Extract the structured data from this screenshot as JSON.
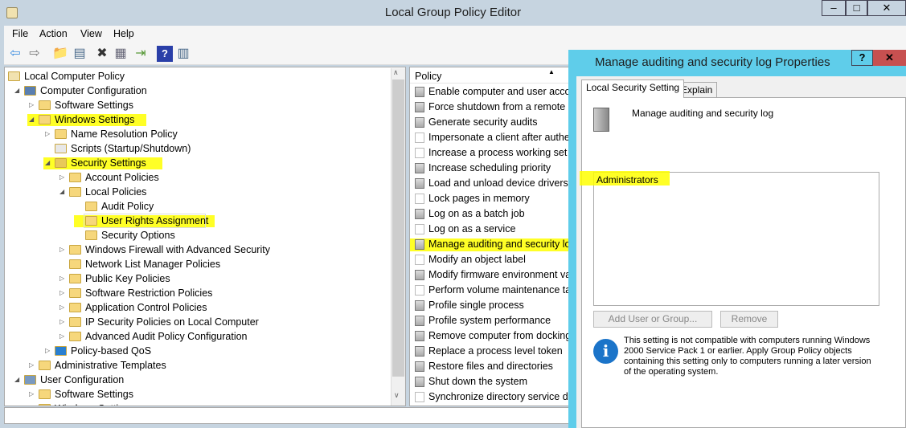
{
  "window": {
    "title": "Local Group Policy Editor",
    "minimize": "–",
    "maximize": "□",
    "close": "✕"
  },
  "menu": [
    "File",
    "Action",
    "View",
    "Help"
  ],
  "toolbar": [
    {
      "icon": "back-arrow-icon",
      "glyph": "⇦"
    },
    {
      "icon": "forward-arrow-icon",
      "glyph": "⇨"
    },
    {
      "icon": "up-folder-icon",
      "glyph": "📁"
    },
    {
      "icon": "show-hide-tree-icon",
      "glyph": "▤"
    },
    {
      "icon": "delete-icon",
      "glyph": "✖"
    },
    {
      "icon": "properties-icon",
      "glyph": "▦"
    },
    {
      "icon": "export-list-icon",
      "glyph": "⇥"
    },
    {
      "icon": "help-icon",
      "glyph": "?"
    },
    {
      "icon": "show-action-pane-icon",
      "glyph": "▥"
    }
  ],
  "tree": [
    {
      "label": "Local Computer Policy",
      "level": 0,
      "arrow": "",
      "icon": "scroll"
    },
    {
      "label": "Computer Configuration",
      "level": 1,
      "arrow": "◢",
      "icon": "computer"
    },
    {
      "label": "Software Settings",
      "level": 2,
      "arrow": "▷",
      "icon": "folder"
    },
    {
      "label": "Windows Settings",
      "level": 2,
      "arrow": "◢",
      "icon": "folder",
      "highlight": true
    },
    {
      "label": "Name Resolution Policy",
      "level": 3,
      "arrow": "▷",
      "icon": "folder"
    },
    {
      "label": "Scripts (Startup/Shutdown)",
      "level": 3,
      "arrow": "",
      "icon": "script"
    },
    {
      "label": "Security Settings",
      "level": 3,
      "arrow": "◢",
      "icon": "security",
      "highlight": true
    },
    {
      "label": "Account Policies",
      "level": 4,
      "arrow": "▷",
      "icon": "folder"
    },
    {
      "label": "Local Policies",
      "level": 4,
      "arrow": "◢",
      "icon": "folder"
    },
    {
      "label": "Audit Policy",
      "level": 5,
      "arrow": "",
      "icon": "folder"
    },
    {
      "label": "User Rights Assignment",
      "level": 5,
      "arrow": "",
      "icon": "folder",
      "highlight": true,
      "selected": true
    },
    {
      "label": "Security Options",
      "level": 5,
      "arrow": "",
      "icon": "folder"
    },
    {
      "label": "Windows Firewall with Advanced Security",
      "level": 4,
      "arrow": "▷",
      "icon": "folder"
    },
    {
      "label": "Network List Manager Policies",
      "level": 4,
      "arrow": "",
      "icon": "folder"
    },
    {
      "label": "Public Key Policies",
      "level": 4,
      "arrow": "▷",
      "icon": "folder"
    },
    {
      "label": "Software Restriction Policies",
      "level": 4,
      "arrow": "▷",
      "icon": "folder"
    },
    {
      "label": "Application Control Policies",
      "level": 4,
      "arrow": "▷",
      "icon": "folder"
    },
    {
      "label": "IP Security Policies on Local Computer",
      "level": 4,
      "arrow": "▷",
      "icon": "folder"
    },
    {
      "label": "Advanced Audit Policy Configuration",
      "level": 4,
      "arrow": "▷",
      "icon": "folder"
    },
    {
      "label": "Policy-based QoS",
      "level": 3,
      "arrow": "▷",
      "icon": "chart"
    },
    {
      "label": "Administrative Templates",
      "level": 2,
      "arrow": "▷",
      "icon": "folder"
    },
    {
      "label": "User Configuration",
      "level": 1,
      "arrow": "◢",
      "icon": "user"
    },
    {
      "label": "Software Settings",
      "level": 2,
      "arrow": "▷",
      "icon": "folder"
    },
    {
      "label": "Windows Settings",
      "level": 2,
      "arrow": "▷",
      "icon": "folder"
    }
  ],
  "policy": {
    "header": "Policy",
    "sort": "▲",
    "items": [
      {
        "label": "Enable computer and user accounts to be trusted for delegation",
        "bin": false
      },
      {
        "label": "Force shutdown from a remote system",
        "bin": false
      },
      {
        "label": "Generate security audits",
        "bin": false
      },
      {
        "label": "Impersonate a client after authentication",
        "bin": true
      },
      {
        "label": "Increase a process working set",
        "bin": true
      },
      {
        "label": "Increase scheduling priority",
        "bin": false
      },
      {
        "label": "Load and unload device drivers",
        "bin": false
      },
      {
        "label": "Lock pages in memory",
        "bin": true
      },
      {
        "label": "Log on as a batch job",
        "bin": false
      },
      {
        "label": "Log on as a service",
        "bin": true
      },
      {
        "label": "Manage auditing and security log",
        "bin": false,
        "highlight": true
      },
      {
        "label": "Modify an object label",
        "bin": true
      },
      {
        "label": "Modify firmware environment values",
        "bin": false
      },
      {
        "label": "Perform volume maintenance tasks",
        "bin": true
      },
      {
        "label": "Profile single process",
        "bin": false
      },
      {
        "label": "Profile system performance",
        "bin": false
      },
      {
        "label": "Remove computer from docking station",
        "bin": false
      },
      {
        "label": "Replace a process level token",
        "bin": false
      },
      {
        "label": "Restore files and directories",
        "bin": false
      },
      {
        "label": "Shut down the system",
        "bin": false
      },
      {
        "label": "Synchronize directory service data",
        "bin": true
      }
    ]
  },
  "dialog": {
    "title": "Manage auditing and security log Properties",
    "help": "?",
    "close": "✕",
    "tabs": [
      "Local Security Setting",
      "Explain"
    ],
    "setting_name": "Manage auditing and security log",
    "members": [
      "Administrators"
    ],
    "add_button": "Add User or Group...",
    "remove_button": "Remove",
    "info": "This setting is not compatible with computers running Windows 2000 Service Pack 1 or earlier.  Apply Group Policy objects containing this setting only to computers running a later version of the operating system."
  },
  "colors": {
    "highlight": "#ffff00",
    "dialog_frame": "#5fcdea",
    "close_red": "#c75050"
  }
}
